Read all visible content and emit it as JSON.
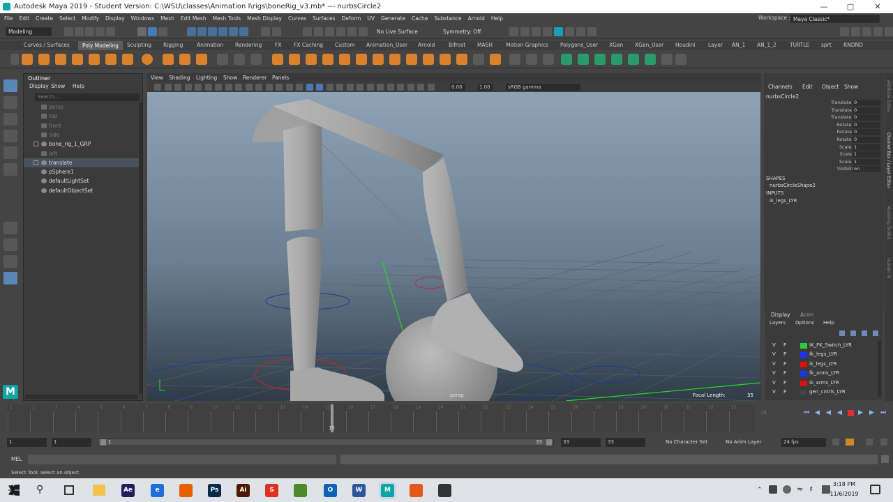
{
  "window": {
    "title": "Autodesk Maya 2019 - Student Version: C:\\WSU\\classes\\Animation I\\rigs\\boneRig_v3.mb*  ---  nurbsCircle2"
  },
  "menubar": [
    "File",
    "Edit",
    "Create",
    "Select",
    "Modify",
    "Display",
    "Windows",
    "Mesh",
    "Edit Mesh",
    "Mesh Tools",
    "Mesh Display",
    "Curves",
    "Surfaces",
    "Deform",
    "UV",
    "Generate",
    "Cache",
    "Substance",
    "Arnold",
    "Help"
  ],
  "workspace": {
    "label": "Workspace :",
    "value": "Maya Classic*"
  },
  "statusline": {
    "mode": "Modeling",
    "live_surface": "No Live Surface",
    "symmetry": "Symmetry: Off"
  },
  "shelf_tabs": [
    "Curves / Surfaces",
    "Poly Modeling",
    "Sculpting",
    "Rigging",
    "Animation",
    "Rendering",
    "FX",
    "FX Caching",
    "Custom",
    "Animation_User",
    "Arnold",
    "Bifrost",
    "MASH",
    "Motion Graphics",
    "Polygons_User",
    "XGen",
    "XGen_User",
    "Houdini",
    "Layer",
    "AN_1",
    "AN_1_2",
    "TURTLE",
    "sprt",
    "RNDND"
  ],
  "active_shelf": "Poly Modeling",
  "outliner": {
    "title": "Outliner",
    "menu": [
      "Display",
      "Show",
      "Help"
    ],
    "search_placeholder": "Search...",
    "items": [
      {
        "label": "persp",
        "dim": true
      },
      {
        "label": "top",
        "dim": true
      },
      {
        "label": "front",
        "dim": true
      },
      {
        "label": "side",
        "dim": true
      },
      {
        "label": "bone_rig_1_GRP",
        "dim": false
      },
      {
        "label": "left",
        "dim": true
      },
      {
        "label": "translate",
        "dim": false,
        "selected": true
      },
      {
        "label": "pSphere1",
        "dim": false
      },
      {
        "label": "defaultLightSet",
        "dim": false
      },
      {
        "label": "defaultObjectSet",
        "dim": false
      }
    ]
  },
  "viewport": {
    "menu": [
      "View",
      "Shading",
      "Lighting",
      "Show",
      "Renderer",
      "Panels"
    ],
    "exposure": "0.00",
    "gamma": "1.00",
    "colorspace": "sRGB gamma",
    "camera_label": "persp",
    "focal_label": "Focal Length:",
    "focal_value": "35"
  },
  "channelbox": {
    "menu": [
      "Channels",
      "Edit",
      "Object",
      "Show"
    ],
    "object": "nurbsCircle2",
    "channels": [
      {
        "name": "Translate X",
        "value": "0"
      },
      {
        "name": "Translate Y",
        "value": "0"
      },
      {
        "name": "Translate Z",
        "value": "0"
      },
      {
        "name": "Rotate X",
        "value": "0"
      },
      {
        "name": "Rotate Y",
        "value": "0"
      },
      {
        "name": "Rotate Z",
        "value": "0"
      },
      {
        "name": "Scale X",
        "value": "1"
      },
      {
        "name": "Scale Y",
        "value": "1"
      },
      {
        "name": "Scale Z",
        "value": "1"
      },
      {
        "name": "Visibility",
        "value": "on"
      }
    ],
    "shapes_label": "SHAPES",
    "shape": "nurbsCircleShape2",
    "inputs_label": "INPUTS",
    "input": "ik_legs_LYR",
    "side_tabs": [
      "Attribute Editor",
      "Channel Box / Layer Editor",
      "Modeling Toolkit",
      "Human IK"
    ]
  },
  "layers": {
    "tabs": [
      "Display",
      "Anim"
    ],
    "menu": [
      "Layers",
      "Options",
      "Help"
    ],
    "rows": [
      {
        "v": "V",
        "p": "P",
        "name": "IK_FK_Switch_LYR",
        "color": "#2ecc40"
      },
      {
        "v": "V",
        "p": "P",
        "name": "fk_legs_LYR",
        "color": "#1a33ff"
      },
      {
        "v": "V",
        "p": "P",
        "name": "ik_legs_LYR",
        "color": "#e01010"
      },
      {
        "v": "V",
        "p": "P",
        "name": "fk_arms_LYR",
        "color": "#1a33ff"
      },
      {
        "v": "V",
        "p": "P",
        "name": "ik_arms_LYR",
        "color": "#e01010"
      },
      {
        "v": "V",
        "p": "P",
        "name": "gen_cntrls_LYR",
        "color": "#444444"
      }
    ]
  },
  "timeline": {
    "ticks": [
      "1",
      "2",
      "3",
      "4",
      "5",
      "6",
      "7",
      "8",
      "9",
      "10",
      "11",
      "12",
      "13",
      "14",
      "15",
      "16",
      "17",
      "18",
      "19",
      "20",
      "21",
      "22",
      "23",
      "24",
      "25",
      "26",
      "27",
      "28",
      "29",
      "30",
      "31",
      "32",
      "33"
    ],
    "current_frame": "15",
    "end_marker": "16"
  },
  "range": {
    "start": "1",
    "start2": "1",
    "slider_start": "1",
    "slider_end": "33",
    "end": "33",
    "end2": "33",
    "char_set": "No Character Set",
    "anim_layer": "No Anim Layer",
    "fps": "24 fps"
  },
  "cmdline": {
    "label": "MEL"
  },
  "helpline": "Select Tool: select an object",
  "taskbar": {
    "apps": [
      {
        "label": "Ae",
        "color": "#1f1f5e"
      },
      {
        "label": "e",
        "color": "#1e6fd9"
      },
      {
        "label": "",
        "color": "#e66000"
      },
      {
        "label": "Ps",
        "color": "#0b2a4a"
      },
      {
        "label": "Ai",
        "color": "#4a1a00"
      },
      {
        "label": "S",
        "color": "#e0301e"
      },
      {
        "label": "",
        "color": "#4c8a2a"
      },
      {
        "label": "O",
        "color": "#0f62b5"
      },
      {
        "label": "W",
        "color": "#2b579a"
      },
      {
        "label": "M",
        "color": "#0aa6a6"
      },
      {
        "label": "",
        "color": "#e05a1a"
      },
      {
        "label": "",
        "color": "#333333"
      }
    ],
    "time": "3:18 PM",
    "date": "11/6/2019"
  }
}
